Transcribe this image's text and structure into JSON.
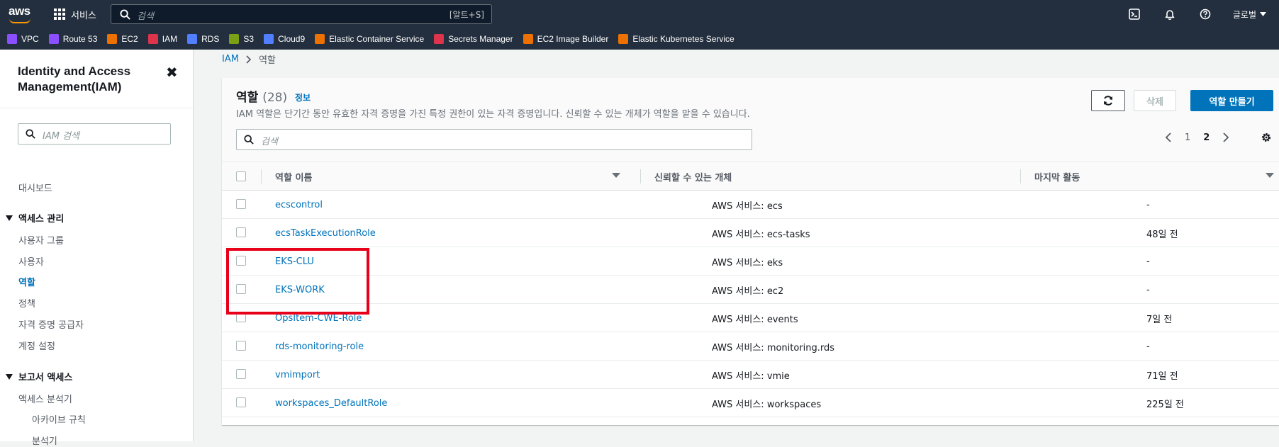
{
  "topnav": {
    "logo": "aws",
    "services_label": "서비스",
    "search_placeholder": "검색",
    "search_shortcut": "[알트+S]",
    "region_label": "글로벌",
    "favorites": [
      {
        "label": "VPC",
        "color": "#8c4fff"
      },
      {
        "label": "Route 53",
        "color": "#8c4fff"
      },
      {
        "label": "EC2",
        "color": "#ed7100"
      },
      {
        "label": "IAM",
        "color": "#dd344c"
      },
      {
        "label": "RDS",
        "color": "#527fff"
      },
      {
        "label": "S3",
        "color": "#7aa116"
      },
      {
        "label": "Cloud9",
        "color": "#527fff"
      },
      {
        "label": "Elastic Container Service",
        "color": "#ed7100"
      },
      {
        "label": "Secrets Manager",
        "color": "#dd344c"
      },
      {
        "label": "EC2 Image Builder",
        "color": "#ed7100"
      },
      {
        "label": "Elastic Kubernetes Service",
        "color": "#ed7100"
      }
    ]
  },
  "sidebar": {
    "title": "Identity and Access Management(IAM)",
    "search_placeholder": "IAM 검색",
    "dashboard": "대시보드",
    "access_management": {
      "label": "액세스 관리",
      "items": [
        "사용자 그룹",
        "사용자",
        "역할",
        "정책",
        "자격 증명 공급자",
        "계정 설정"
      ]
    },
    "access_reports": {
      "label": "보고서 액세스",
      "items": [
        "액세스 분석기",
        "아카이브 규칙",
        "분석기"
      ]
    }
  },
  "breadcrumb": {
    "root": "IAM",
    "current": "역할"
  },
  "roles_panel": {
    "title": "역할",
    "count": "(28)",
    "info": "정보",
    "description": "IAM 역할은 단기간 동안 유효한 자격 증명을 가진 특정 권한이 있는 자격 증명입니다. 신뢰할 수 있는 개체가 역할을 맡을 수 있습니다.",
    "delete_label": "삭제",
    "create_label": "역할 만들기",
    "search_placeholder": "검색",
    "pages": [
      "1",
      "2"
    ],
    "columns": [
      "역할 이름",
      "신뢰할 수 있는 개체",
      "마지막 활동"
    ],
    "rows": [
      {
        "name": "ecscontrol",
        "trusted": "AWS 서비스: ecs",
        "last": "-"
      },
      {
        "name": "ecsTaskExecutionRole",
        "trusted": "AWS 서비스: ecs-tasks",
        "last": "48일 전"
      },
      {
        "name": "EKS-CLU",
        "trusted": "AWS 서비스: eks",
        "last": "-"
      },
      {
        "name": "EKS-WORK",
        "trusted": "AWS 서비스: ec2",
        "last": "-"
      },
      {
        "name": "OpsItem-CWE-Role",
        "trusted": "AWS 서비스: events",
        "last": "7일 전"
      },
      {
        "name": "rds-monitoring-role",
        "trusted": "AWS 서비스: monitoring.rds",
        "last": "-"
      },
      {
        "name": "vmimport",
        "trusted": "AWS 서비스: vmie",
        "last": "71일 전"
      },
      {
        "name": "workspaces_DefaultRole",
        "trusted": "AWS 서비스: workspaces",
        "last": "225일 전"
      }
    ]
  },
  "colors": {
    "nav_bg": "#232f3e",
    "link": "#0073bb",
    "primary_button": "#0073bb",
    "highlight_box": "#e8001a"
  }
}
